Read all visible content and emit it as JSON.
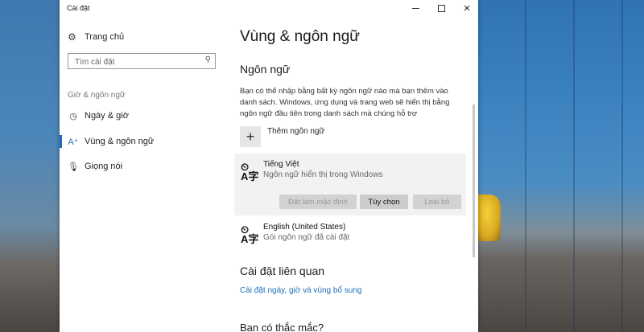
{
  "window": {
    "title": "Cài đặt",
    "controls": {
      "minimize": "minimize",
      "maximize": "maximize",
      "close": "✕"
    }
  },
  "sidebar": {
    "home_label": "Trang chủ",
    "search": {
      "placeholder": "Tìm cài đặt",
      "value": ""
    },
    "section_label": "Giờ & ngôn ngữ",
    "items": [
      {
        "label": "Ngày & giờ",
        "icon": "calendar-clock-icon",
        "active": false
      },
      {
        "label": "Vùng & ngôn ngữ",
        "icon": "region-language-icon",
        "active": true
      },
      {
        "label": "Giọng nói",
        "icon": "microphone-icon",
        "active": false
      }
    ]
  },
  "main": {
    "title": "Vùng & ngôn ngữ",
    "languages_heading": "Ngôn ngữ",
    "description": "Bạn có thể nhập bằng bất kỳ ngôn ngữ nào mà bạn thêm vào danh sách. Windows, ứng dụng và trang web sẽ hiển thị bằng ngôn ngữ đầu tiên trong danh sách mà chúng hỗ trợ",
    "add_language_label": "Thêm ngôn ngữ",
    "languages": [
      {
        "name": "Tiếng Việt",
        "subtitle": "Ngôn ngữ hiển thị trong Windows",
        "selected": true,
        "buttons": {
          "set_default": "Đặt làm mặc định",
          "options": "Tùy chọn",
          "remove": "Loại bỏ"
        }
      },
      {
        "name": "English (United States)",
        "subtitle": "Gói ngôn ngữ đã cài đặt",
        "selected": false
      }
    ],
    "related_heading": "Cài đặt liên quan",
    "related_link": "Cài đặt ngày, giờ và vùng bổ sung",
    "question_heading": "Bạn có thắc mắc?"
  },
  "colors": {
    "accent": "#1d6fb8",
    "card_bg": "#f2f2f2",
    "window_bg": "#ffffff"
  }
}
